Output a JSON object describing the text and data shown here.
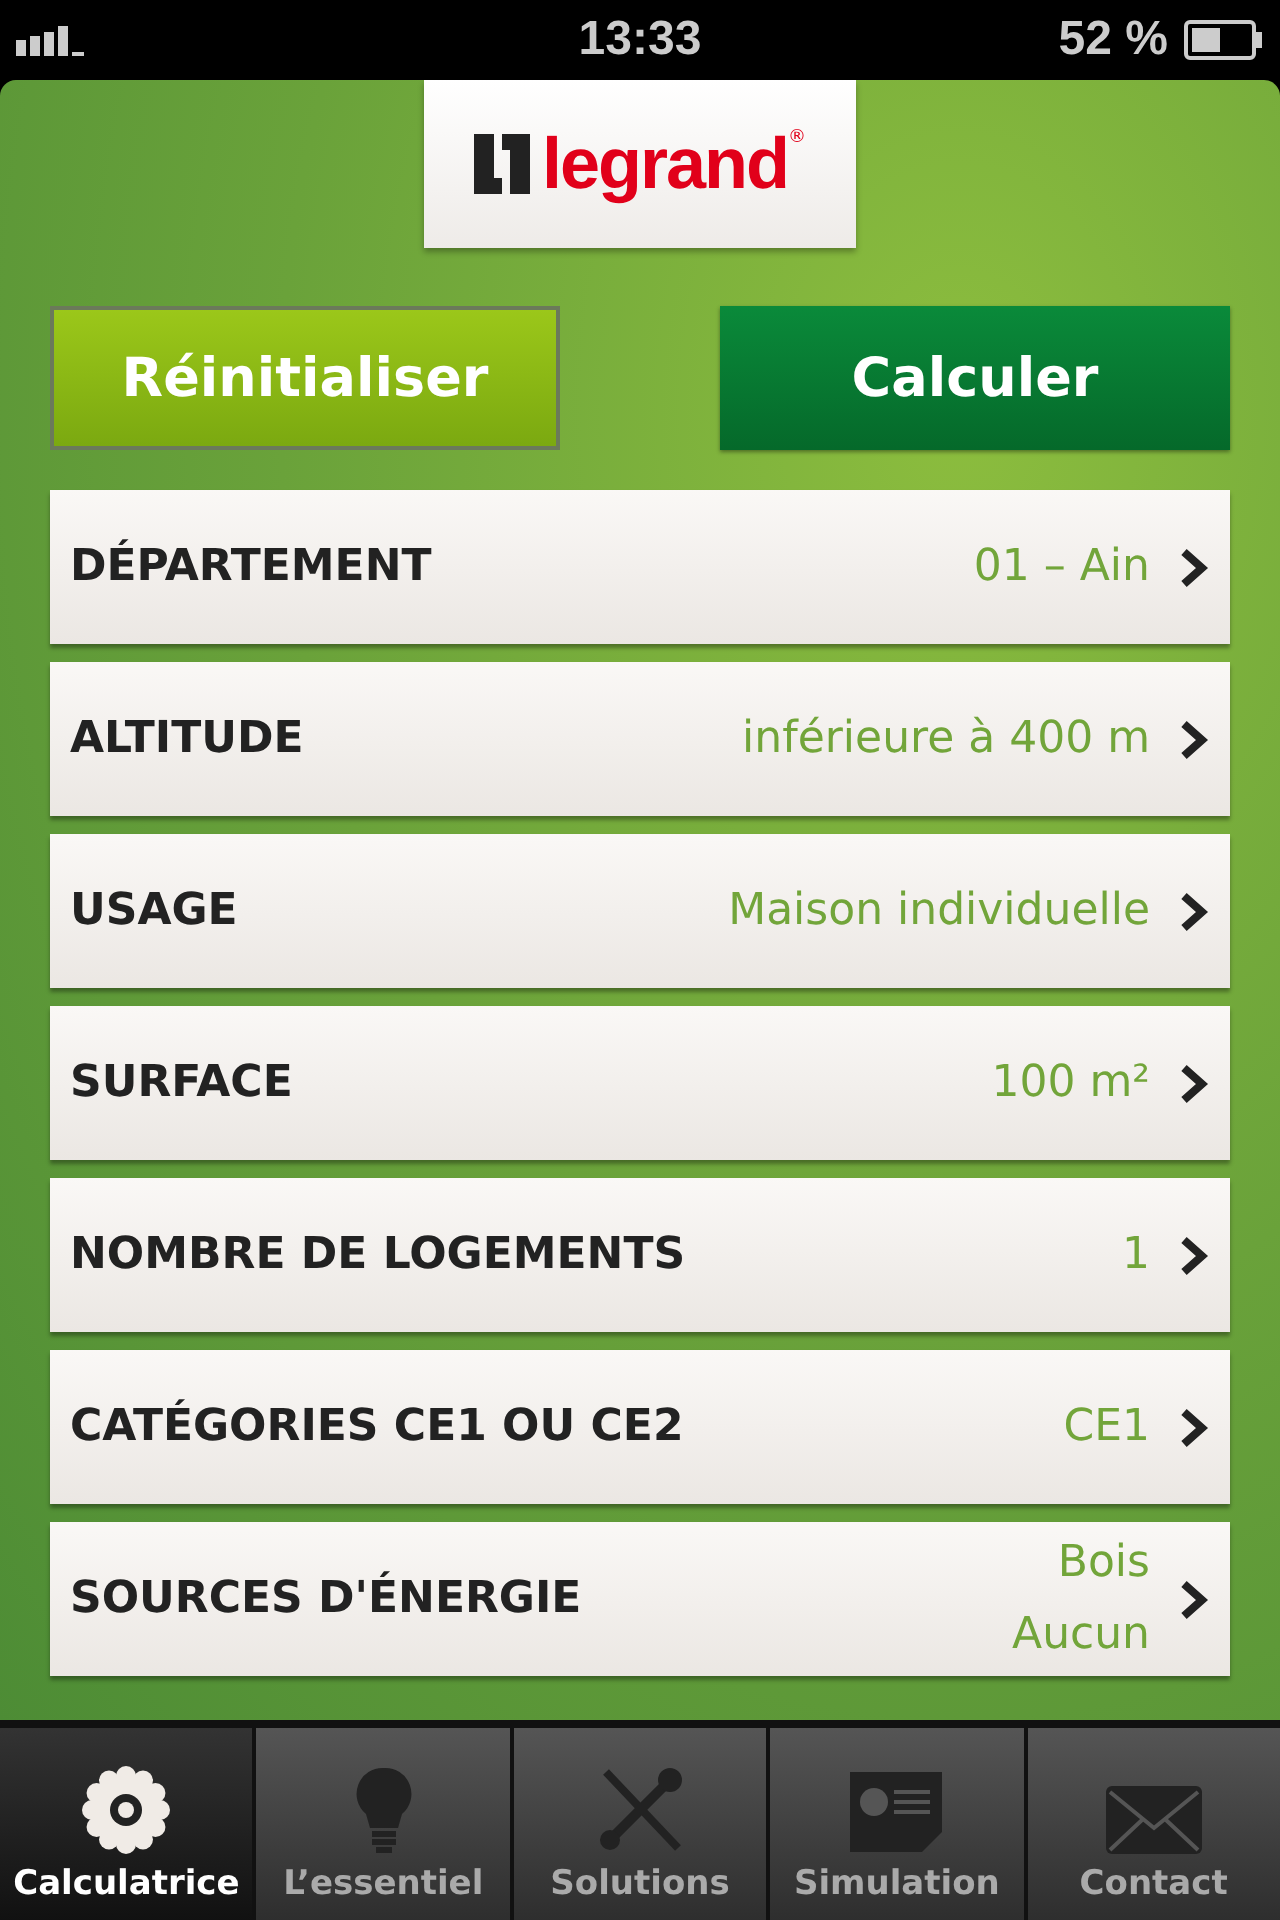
{
  "status_bar": {
    "time": "13:33",
    "battery": "52 %"
  },
  "logo": {
    "text": "legrand",
    "mark": "®"
  },
  "buttons": [
    {
      "label": "Réinitialiser",
      "kind": "secondary"
    },
    {
      "label": "Calculer",
      "kind": "primary"
    }
  ],
  "rows": [
    {
      "label": "DÉPARTEMENT",
      "values": [
        "01 – Ain"
      ]
    },
    {
      "label": "ALTITUDE",
      "values": [
        "inférieure à 400 m"
      ]
    },
    {
      "label": "USAGE",
      "values": [
        "Maison individuelle"
      ]
    },
    {
      "label": "SURFACE",
      "values": [
        "100 m²"
      ]
    },
    {
      "label": "NOMBRE DE LOGEMENTS",
      "values": [
        "1"
      ]
    },
    {
      "label": "CATÉGORIES CE1 OU CE2",
      "values": [
        "CE1"
      ]
    },
    {
      "label": "SOURCES D'ÉNERGIE",
      "values": [
        "Bois",
        "Aucun"
      ]
    }
  ],
  "tab_bar": [
    {
      "label": "Calculatrice",
      "selected": true
    },
    {
      "label": "L’essentiel",
      "selected": false
    },
    {
      "label": "Solutions",
      "selected": false
    },
    {
      "label": "Simulation",
      "selected": false
    },
    {
      "label": "Contact",
      "selected": false
    }
  ]
}
